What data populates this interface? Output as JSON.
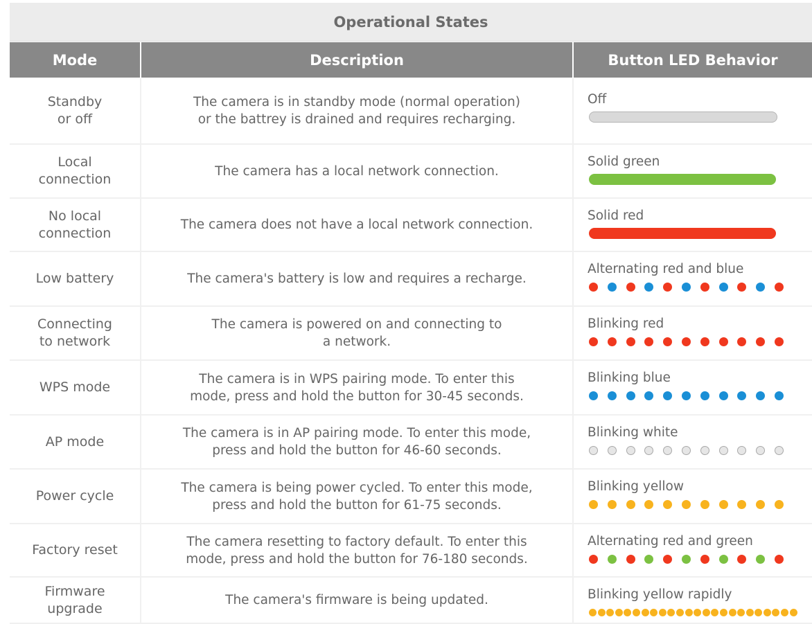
{
  "title": "Operational States",
  "headers": {
    "mode": "Mode",
    "description": "Description",
    "led": "Button LED Behavior"
  },
  "colors": {
    "off": "#d9d9d9",
    "off_border": "#b5b5b5",
    "green": "#7cc142",
    "red": "#f0381e",
    "blue": "#1a8fd6",
    "white_dot": "#e6e6e6",
    "white_dot_border": "#a8a8a8",
    "yellow": "#f8b31e"
  },
  "rows": [
    {
      "mode": [
        "Standby",
        "or off"
      ],
      "description": [
        "The camera is in standby mode (normal operation)",
        "or the battrey is drained and requires recharging."
      ],
      "led_label": "Off",
      "pattern": {
        "kind": "bar",
        "color": "off"
      }
    },
    {
      "mode": [
        "Local",
        "connection"
      ],
      "description": [
        "The camera has a local network connection."
      ],
      "led_label": "Solid green",
      "pattern": {
        "kind": "bar",
        "color": "green"
      }
    },
    {
      "mode": [
        "No local",
        "connection"
      ],
      "description": [
        "The camera does not have a local network connection."
      ],
      "led_label": "Solid red",
      "pattern": {
        "kind": "bar",
        "color": "red"
      }
    },
    {
      "mode": [
        "Low battery"
      ],
      "description": [
        "The camera's battery is low and requires a recharge."
      ],
      "led_label": "Alternating red and blue",
      "pattern": {
        "kind": "dots",
        "colors": [
          "red",
          "blue",
          "red",
          "blue",
          "red",
          "blue",
          "red",
          "blue",
          "red",
          "blue",
          "red"
        ]
      }
    },
    {
      "mode": [
        "Connecting",
        "to network"
      ],
      "description": [
        "The camera is powered on and connecting to",
        "a network."
      ],
      "led_label": "Blinking red",
      "pattern": {
        "kind": "dots",
        "colors": [
          "red",
          "red",
          "red",
          "red",
          "red",
          "red",
          "red",
          "red",
          "red",
          "red",
          "red"
        ]
      }
    },
    {
      "mode": [
        "WPS mode"
      ],
      "description": [
        "The camera is in WPS pairing mode. To enter this",
        "mode, press and hold the button for 30-45 seconds."
      ],
      "led_label": "Blinking blue",
      "pattern": {
        "kind": "dots",
        "colors": [
          "blue",
          "blue",
          "blue",
          "blue",
          "blue",
          "blue",
          "blue",
          "blue",
          "blue",
          "blue",
          "blue"
        ]
      }
    },
    {
      "mode": [
        "AP mode"
      ],
      "description": [
        "The camera is in AP pairing mode. To enter this mode,",
        "press and hold the button for 46-60 seconds."
      ],
      "led_label": "Blinking white",
      "pattern": {
        "kind": "dots",
        "colors": [
          "white",
          "white",
          "white",
          "white",
          "white",
          "white",
          "white",
          "white",
          "white",
          "white",
          "white"
        ]
      }
    },
    {
      "mode": [
        "Power cycle"
      ],
      "description": [
        "The camera is being power cycled. To enter this mode,",
        "press and hold the button for 61-75 seconds."
      ],
      "led_label": "Blinking yellow",
      "pattern": {
        "kind": "dots",
        "colors": [
          "yellow",
          "yellow",
          "yellow",
          "yellow",
          "yellow",
          "yellow",
          "yellow",
          "yellow",
          "yellow",
          "yellow",
          "yellow"
        ]
      }
    },
    {
      "mode": [
        "Factory reset"
      ],
      "description": [
        "The camera resetting to factory default. To enter this",
        "mode, press and hold the button for 76-180 seconds."
      ],
      "led_label": "Alternating red and green",
      "pattern": {
        "kind": "dots",
        "colors": [
          "red",
          "green",
          "red",
          "green",
          "red",
          "green",
          "red",
          "green",
          "red",
          "green",
          "red"
        ]
      }
    },
    {
      "mode": [
        "Firmware",
        "upgrade"
      ],
      "description": [
        "The camera's firmware is being updated."
      ],
      "led_label": "Blinking yellow rapidly",
      "pattern": {
        "kind": "rapid",
        "colors": [
          "yellow",
          "yellow",
          "yellow",
          "yellow",
          "yellow",
          "yellow",
          "yellow",
          "yellow",
          "yellow",
          "yellow",
          "yellow",
          "yellow",
          "yellow",
          "yellow",
          "yellow",
          "yellow",
          "yellow",
          "yellow",
          "yellow",
          "yellow",
          "yellow",
          "yellow",
          "yellow",
          "yellow"
        ]
      }
    }
  ]
}
